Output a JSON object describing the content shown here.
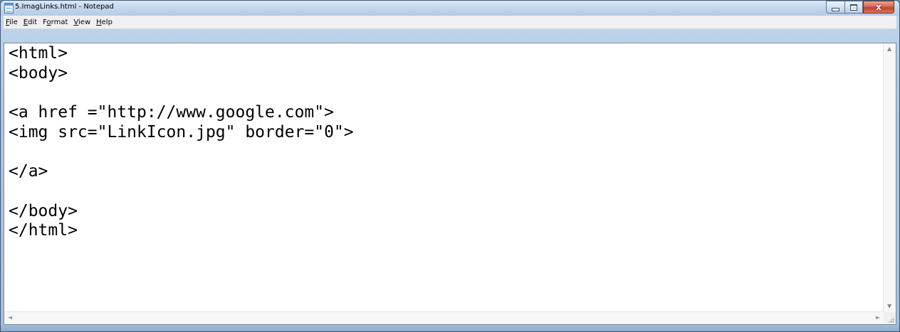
{
  "window": {
    "title": "5.ImagLinks.html - Notepad",
    "icon": "notepad-icon"
  },
  "caption_buttons": {
    "minimize_icon": "minimize-icon",
    "maximize_icon": "maximize-icon",
    "close_icon": "close-icon",
    "close_glyph": "x"
  },
  "menu": {
    "items": [
      {
        "accel": "F",
        "rest": "ile"
      },
      {
        "accel": "E",
        "rest": "dit"
      },
      {
        "pre": "F",
        "accel": "o",
        "rest": "rmat"
      },
      {
        "accel": "V",
        "rest": "iew"
      },
      {
        "accel": "H",
        "rest": "elp"
      }
    ]
  },
  "editor": {
    "lines": [
      "<html>",
      "<body>",
      "",
      "<a href =\"http://www.google.com\">",
      "<img src=\"LinkIcon.jpg\" border=\"0\">",
      "",
      "</a>",
      "",
      "</body>",
      "</html>"
    ]
  },
  "scrollbars": {
    "up": "▲",
    "down": "▼",
    "left": "◄",
    "right": "►"
  },
  "colors": {
    "title_bar": "#c4d8ee",
    "close_button": "#c2422c",
    "editor_background": "#ffffff",
    "text": "#000000"
  }
}
